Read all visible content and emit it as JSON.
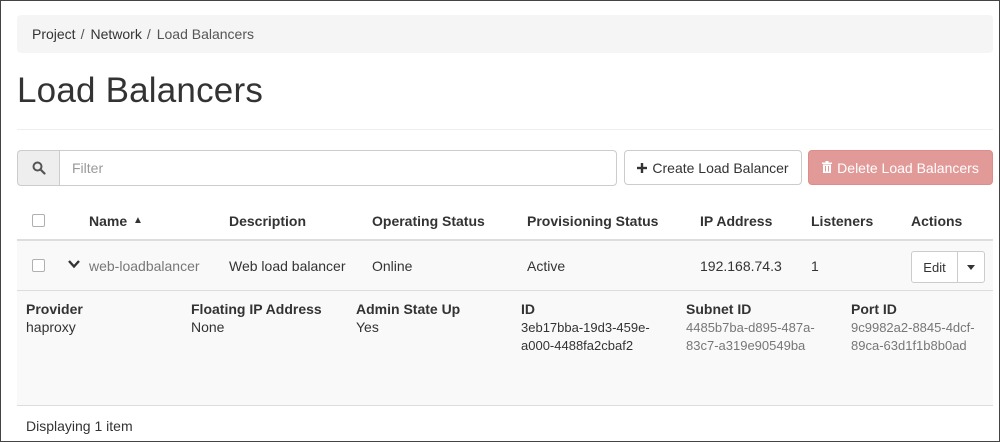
{
  "breadcrumb": {
    "items": [
      "Project",
      "Network",
      "Load Balancers"
    ],
    "separator": "/"
  },
  "page": {
    "title": "Load Balancers"
  },
  "toolbar": {
    "filter_placeholder": "Filter",
    "search_icon": "search-icon",
    "create_label": "Create Load Balancer",
    "delete_label": "Delete Load Balancers"
  },
  "table": {
    "headers": {
      "name": "Name",
      "description": "Description",
      "operating_status": "Operating Status",
      "provisioning_status": "Provisioning Status",
      "ip_address": "IP Address",
      "listeners": "Listeners",
      "actions": "Actions"
    },
    "sort_indicator": "▲",
    "rows": [
      {
        "name": "web-loadbalancer",
        "description": "Web load balancer",
        "operating_status": "Online",
        "provisioning_status": "Active",
        "ip_address": "192.168.74.3",
        "listeners": "1",
        "edit_label": "Edit"
      }
    ]
  },
  "detail": {
    "provider_label": "Provider",
    "provider_value": "haproxy",
    "floating_ip_label": "Floating IP Address",
    "floating_ip_value": "None",
    "admin_state_label": "Admin State Up",
    "admin_state_value": "Yes",
    "id_label": "ID",
    "id_value": "3eb17bba-19d3-459e-a000-4488fa2cbaf2",
    "subnet_id_label": "Subnet ID",
    "subnet_id_value": "4485b7ba-d895-487a-83c7-a319e90549ba",
    "port_id_label": "Port ID",
    "port_id_value": "9c9982a2-8845-4dcf-89ca-63d1f1b8b0ad"
  },
  "footer": {
    "count_text": "Displaying 1 item"
  },
  "colors": {
    "delete_button": "#e29a98",
    "breadcrumb_bg": "#f5f5f5",
    "row_bg": "#f9f9f9",
    "link_muted": "#777777"
  }
}
